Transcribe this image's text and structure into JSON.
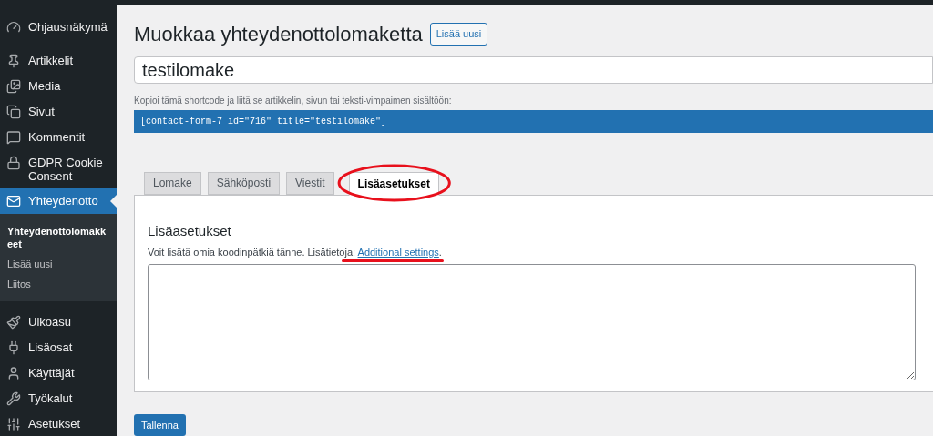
{
  "sidebar": {
    "items": [
      {
        "label": "Ohjausnäkymä",
        "selected": false
      },
      {
        "label": "Artikkelit",
        "selected": false
      },
      {
        "label": "Media",
        "selected": false
      },
      {
        "label": "Sivut",
        "selected": false
      },
      {
        "label": "Kommentit",
        "selected": false
      },
      {
        "label": "GDPR Cookie Consent",
        "selected": false
      },
      {
        "label": "Yhteydenotto",
        "selected": true,
        "children": [
          {
            "label": "Yhteydenottolomakkeet",
            "selected": true
          },
          {
            "label": "Lisää uusi",
            "selected": false
          },
          {
            "label": "Liitos",
            "selected": false
          }
        ]
      },
      {
        "label": "Ulkoasu",
        "selected": false
      },
      {
        "label": "Lisäosat",
        "selected": false
      },
      {
        "label": "Käyttäjät",
        "selected": false
      },
      {
        "label": "Työkalut",
        "selected": false
      },
      {
        "label": "Asetukset",
        "selected": false
      }
    ]
  },
  "page": {
    "title": "Muokkaa yhteydenottolomaketta",
    "add_new_button": "Lisää uusi",
    "form_title": "testilomake",
    "shortcode_hint": "Kopioi tämä shortcode ja liitä se artikkelin, sivun tai teksti-vimpaimen sisältöön:",
    "shortcode": "[contact-form-7 id=\"716\" title=\"testilomake\"]",
    "tabs": [
      {
        "label": "Lomake",
        "selected": false
      },
      {
        "label": "Sähköposti",
        "selected": false
      },
      {
        "label": "Viestit",
        "selected": false
      },
      {
        "label": "Lisäasetukset",
        "selected": true
      }
    ],
    "panel": {
      "heading": "Lisäasetukset",
      "description": "Voit lisätä omia koodinpätkiä tänne. Lisätietoja: ",
      "link": "Additional settings",
      "after_link": "."
    },
    "save_button": "Tallenna"
  }
}
